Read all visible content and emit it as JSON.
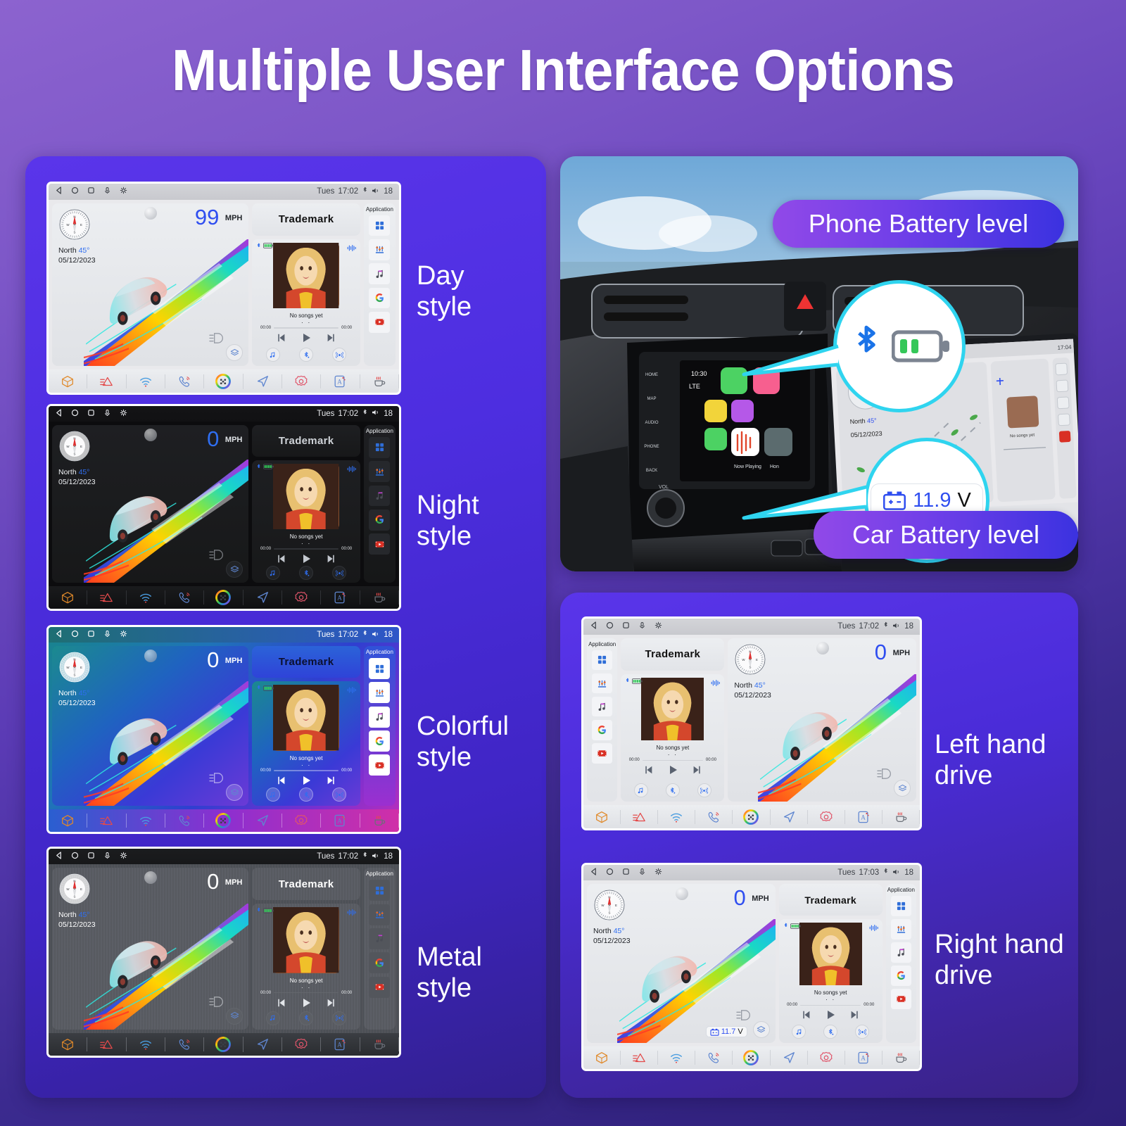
{
  "page": {
    "title": "Multiple User Interface Options"
  },
  "status_bar": {
    "icons": [
      "back-icon",
      "home-icon",
      "recents-icon",
      "mic-icon",
      "brightness-icon"
    ],
    "day": "Tues",
    "time": "17:02",
    "time_alt": "17:03",
    "bt_icon": "bluetooth-icon",
    "vol_icon": "volume-icon",
    "volume": "18"
  },
  "dash": {
    "speed_99": "99",
    "speed_0": "0",
    "speed_unit": "MPH",
    "compass_dir": "North",
    "compass_deg": "45°",
    "date": "05/12/2023",
    "trademark": "Trademark",
    "application_label": "Application",
    "app_icons": [
      "apps-grid-icon",
      "equalizer-icon",
      "music-note-icon",
      "google-icon",
      "youtube-icon"
    ],
    "media": {
      "title": "No songs yet",
      "dots": "· ·",
      "time_start": "00:00",
      "time_end": "00:00",
      "controls": [
        "previous-track-icon",
        "play-icon",
        "next-track-icon"
      ],
      "quick": [
        "music-source-icon",
        "bluetooth-audio-icon",
        "radio-icon"
      ],
      "bt_icon": "bluetooth-icon",
      "battery_icon": "phone-battery-icon",
      "eq_icon": "audio-wave-icon"
    },
    "voltage_rhd": "11.7",
    "volt_unit": "V",
    "bottom_icons": [
      "cube-icon",
      "menu-icon",
      "wifi-icon",
      "phone-icon",
      "apps-ring-icon",
      "navigation-icon",
      "settings-icon",
      "app-editor-icon",
      "heater-icon"
    ]
  },
  "styles": [
    {
      "name": "day",
      "label_line1": "Day",
      "label_line2": "style"
    },
    {
      "name": "night",
      "label_line1": "Night",
      "label_line2": "style"
    },
    {
      "name": "colorful",
      "label_line1": "Colorful",
      "label_line2": "style"
    },
    {
      "name": "metal",
      "label_line1": "Metal",
      "label_line2": "style"
    }
  ],
  "drive_modes": [
    {
      "name": "lhd",
      "label_line1": "Left hand",
      "label_line2": "drive"
    },
    {
      "name": "rhd",
      "label_line1": "Right hand",
      "label_line2": "drive"
    }
  ],
  "callouts": {
    "phone_battery": "Phone Battery level",
    "car_battery": "Car Battery level",
    "bubble_icons": [
      "bluetooth-icon",
      "battery-half-icon"
    ],
    "voltage": "11.9",
    "voltage_unit": "V",
    "voltage_icon": "car-battery-icon"
  },
  "colors": {
    "accent_blue": "#2f4ef0",
    "accent_cyan": "#2fd4ef",
    "badge_from": "#9149e8",
    "badge_to": "#3b32e0",
    "card_purple": "#5a35ea",
    "bg_purple": "#8c63cf"
  }
}
